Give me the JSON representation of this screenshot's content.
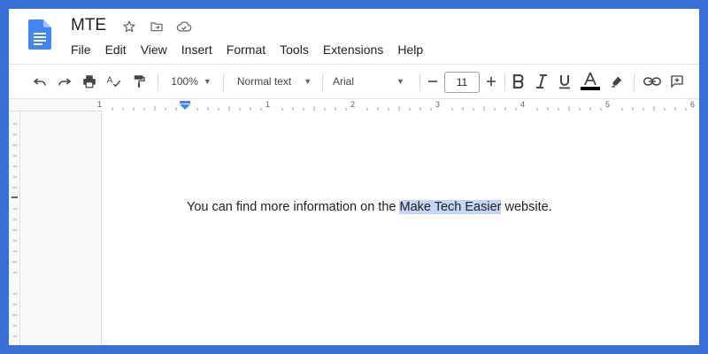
{
  "document": {
    "title": "MTE"
  },
  "title_icons": [
    "star-icon",
    "move-to-folder-icon",
    "cloud-saved-icon"
  ],
  "menu": [
    "File",
    "Edit",
    "View",
    "Insert",
    "Format",
    "Tools",
    "Extensions",
    "Help"
  ],
  "toolbar": {
    "zoom": "100%",
    "style": "Normal text",
    "font": "Arial",
    "font_size": "11",
    "text_color": "#000000"
  },
  "ruler": {
    "labels": [
      "1",
      "1",
      "2",
      "3",
      "4",
      "5",
      "6"
    ]
  },
  "content": {
    "text_before": "You can find more information on the ",
    "highlighted": "Make Tech Easier",
    "text_after": " website."
  },
  "colors": {
    "frame": "#3a6fd8",
    "selection": "#c3d6f5",
    "doc_icon": "#4285f4"
  }
}
